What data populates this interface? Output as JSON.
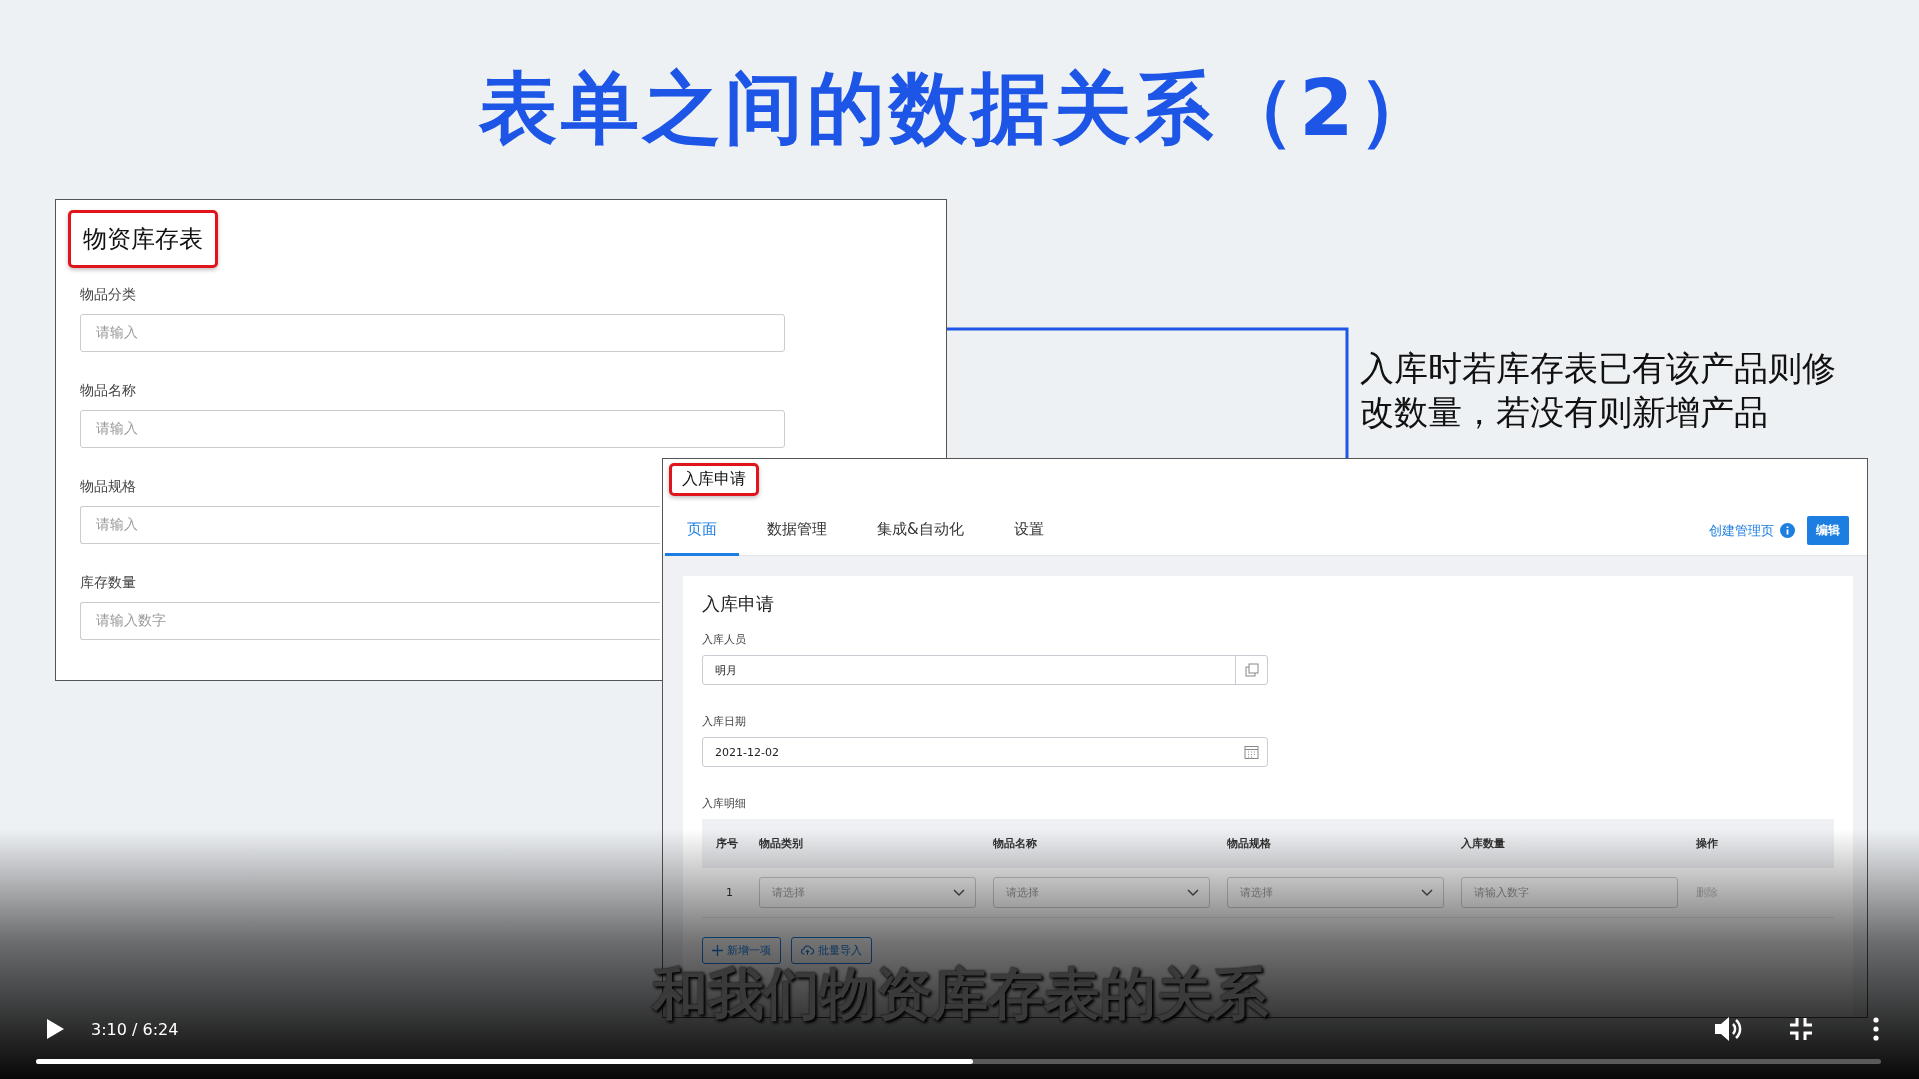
{
  "slide": {
    "title": "表单之间的数据关系（2）",
    "callout": "入库时若库存表已有该产品则修改数量，若没有则新增产品",
    "inventory_form": {
      "title": "物资库存表",
      "fields": [
        {
          "label": "物品分类",
          "placeholder": "请输入"
        },
        {
          "label": "物品名称",
          "placeholder": "请输入"
        },
        {
          "label": "物品规格",
          "placeholder": "请输入"
        },
        {
          "label": "库存数量",
          "placeholder": "请输入数字"
        }
      ]
    },
    "inbound_app": {
      "title": "入库申请",
      "tabs": [
        {
          "label": "页面",
          "selected": true
        },
        {
          "label": "数据管理",
          "selected": false
        },
        {
          "label": "集成&自动化",
          "selected": false
        },
        {
          "label": "设置",
          "selected": false
        }
      ],
      "link": "创建管理页",
      "edit_button": "编辑",
      "form": {
        "title": "入库申请",
        "fields": [
          {
            "label": "入库人员",
            "value": "明月",
            "kind": "person"
          },
          {
            "label": "入库日期",
            "value": "2021-12-02",
            "kind": "date"
          }
        ],
        "detail": {
          "label": "入库明细",
          "columns": [
            "序号",
            "物品类别",
            "物品名称",
            "物品规格",
            "入库数量",
            "操作"
          ],
          "rows": [
            {
              "cells": [
                {
                  "kind": "text",
                  "text": "1"
                },
                {
                  "kind": "select",
                  "placeholder": "请选择"
                },
                {
                  "kind": "select",
                  "placeholder": "请选择"
                },
                {
                  "kind": "select",
                  "placeholder": "请选择"
                },
                {
                  "kind": "number",
                  "placeholder": "请输入数字"
                },
                {
                  "kind": "action",
                  "text": "删除"
                }
              ]
            }
          ],
          "buttons": [
            {
              "label": "新增一项",
              "kind": "add"
            },
            {
              "label": "批量导入",
              "kind": "import"
            }
          ]
        }
      }
    }
  },
  "subtitle": "和我们物资库存表的关系",
  "player": {
    "playing": false,
    "time": "3:10 / 6:24",
    "progress": {
      "level": 0.508
    }
  }
}
